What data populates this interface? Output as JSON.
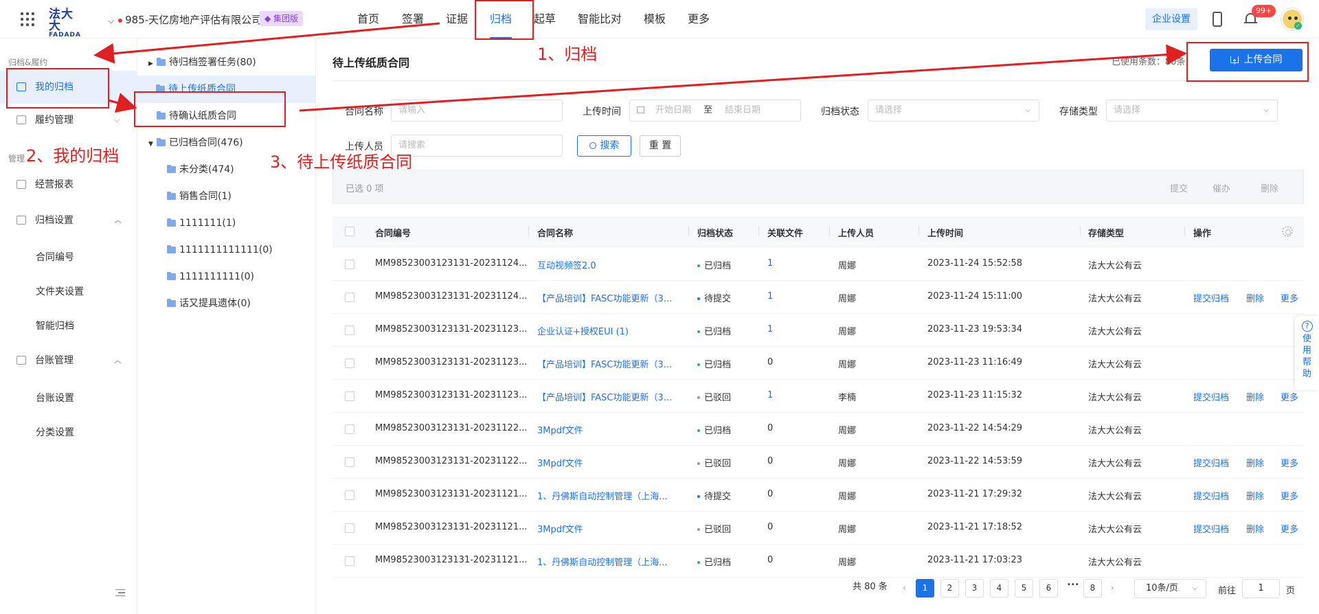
{
  "header": {
    "logo_line1": "法大大",
    "logo_line2": "FADADA",
    "org_name": "985-天亿房地产评估有限公司",
    "org_badge": "集团版",
    "nav": [
      "首页",
      "签署",
      "证据",
      "归档",
      "起草",
      "智能比对",
      "模板",
      "更多"
    ],
    "active_nav": "归档",
    "enterprise_settings": "企业设置",
    "notification_count": "99+"
  },
  "sidebar": {
    "group1": "归档&履约",
    "my_archive": "我的归档",
    "performance": "履约管理",
    "group2": "管理",
    "report": "经营报表",
    "archive_settings": "归档设置",
    "archive_sub": [
      "合同编号",
      "文件夹设置",
      "智能归档"
    ],
    "ledger": "台账管理",
    "ledger_sub": [
      "台账设置",
      "分类设置"
    ]
  },
  "tree": {
    "items": [
      {
        "label": "待归档签署任务(80)"
      },
      {
        "label": "待上传纸质合同"
      },
      {
        "label": "待确认纸质合同"
      },
      {
        "label": "已归档合同(476)"
      },
      {
        "label": "未分类(474)"
      },
      {
        "label": "销售合同(1)"
      },
      {
        "label": "1111111(1)"
      },
      {
        "label": "1111111111111(0)"
      },
      {
        "label": "1111111111(0)"
      },
      {
        "label": "话又提具遗体(0)"
      }
    ]
  },
  "main": {
    "title": "待上传纸质合同",
    "used_quota": "已使用条数：80条",
    "upload_button": "上传合同",
    "filters": {
      "contract_name_label": "合同名称",
      "contract_name_placeholder": "请输入",
      "upload_time_label": "上传时间",
      "start_date": "开始日期",
      "to": "至",
      "end_date": "结束日期",
      "archive_status_label": "归档状态",
      "archive_status_placeholder": "请选择",
      "storage_type_label": "存储类型",
      "storage_type_placeholder": "请选择",
      "uploader_label": "上传人员",
      "uploader_placeholder": "请搜索",
      "search_button": "搜索",
      "reset_button": "重 置"
    },
    "selection": {
      "count": "已选 0 项",
      "submit": "提交",
      "urge": "催办",
      "delete": "删除"
    },
    "table": {
      "columns": [
        "合同编号",
        "合同名称",
        "归档状态",
        "关联文件",
        "上传人员",
        "上传时间",
        "存储类型",
        "操作"
      ],
      "rows": [
        {
          "no": "MM98523003123131-20231124...",
          "name": "互动视频签2.0",
          "status": "已归档",
          "files": "1",
          "uploader": "周娜",
          "time": "2023-11-24 15:52:58",
          "storage": "法大大公有云",
          "ops": []
        },
        {
          "no": "MM98523003123131-20231124...",
          "name": "【产品培训】FASC功能更新（3...",
          "status": "待提交",
          "files": "1",
          "uploader": "周娜",
          "time": "2023-11-24 15:11:00",
          "storage": "法大大公有云",
          "ops": [
            "提交归档",
            "删除",
            "更多"
          ]
        },
        {
          "no": "MM98523003123131-20231123...",
          "name": "企业认证+授权EUI (1)",
          "status": "已归档",
          "files": "1",
          "uploader": "周娜",
          "time": "2023-11-23 19:53:34",
          "storage": "法大大公有云",
          "ops": []
        },
        {
          "no": "MM98523003123131-20231123...",
          "name": "【产品培训】FASC功能更新（3...",
          "status": "已归档",
          "files": "0",
          "uploader": "周娜",
          "time": "2023-11-23 11:16:49",
          "storage": "法大大公有云",
          "ops": []
        },
        {
          "no": "MM98523003123131-20231123...",
          "name": "【产品培训】FASC功能更新（3...",
          "status": "已驳回",
          "files": "1",
          "uploader": "李楠",
          "time": "2023-11-23 11:15:32",
          "storage": "法大大公有云",
          "ops": [
            "提交归档",
            "删除",
            "更多"
          ]
        },
        {
          "no": "MM98523003123131-20231122...",
          "name": "3Mpdf文件",
          "status": "已归档",
          "files": "0",
          "uploader": "周娜",
          "time": "2023-11-22 14:54:29",
          "storage": "法大大公有云",
          "ops": []
        },
        {
          "no": "MM98523003123131-20231122...",
          "name": "3Mpdf文件",
          "status": "已驳回",
          "files": "0",
          "uploader": "周娜",
          "time": "2023-11-22 14:53:59",
          "storage": "法大大公有云",
          "ops": [
            "提交归档",
            "删除",
            "更多"
          ]
        },
        {
          "no": "MM98523003123131-20231121...",
          "name": "1、丹佛斯自动控制管理（上海...",
          "status": "待提交",
          "files": "0",
          "uploader": "周娜",
          "time": "2023-11-21 17:29:32",
          "storage": "法大大公有云",
          "ops": [
            "提交归档",
            "删除",
            "更多"
          ]
        },
        {
          "no": "MM98523003123131-20231121...",
          "name": "3Mpdf文件",
          "status": "已驳回",
          "files": "0",
          "uploader": "周娜",
          "time": "2023-11-21 17:18:52",
          "storage": "法大大公有云",
          "ops": [
            "提交归档",
            "删除",
            "更多"
          ]
        },
        {
          "no": "MM98523003123131-20231121...",
          "name": "1、丹佛斯自动控制管理（上海...",
          "status": "已归档",
          "files": "0",
          "uploader": "周娜",
          "time": "2023-11-21 17:03:23",
          "storage": "法大大公有云",
          "ops": []
        }
      ]
    },
    "pagination": {
      "total": "共 80 条",
      "pages": [
        "1",
        "2",
        "3",
        "4",
        "5",
        "6",
        "8"
      ],
      "ellipsis": "•••",
      "current": "1",
      "page_size": "10条/页",
      "goto_label": "前往",
      "goto_value": "1",
      "page_suffix": "页"
    }
  },
  "help": [
    "使",
    "用",
    "帮",
    "助"
  ],
  "annotations": {
    "step1": "1、归档",
    "step2": "2、我的归档",
    "step3": "3、待上传纸质合同"
  },
  "colors": {
    "accent": "#1a73e8",
    "annotation": "#e02020",
    "status_archived": "#2bb673",
    "status_pending": "#1a73e8",
    "status_rejected": "#999999"
  }
}
